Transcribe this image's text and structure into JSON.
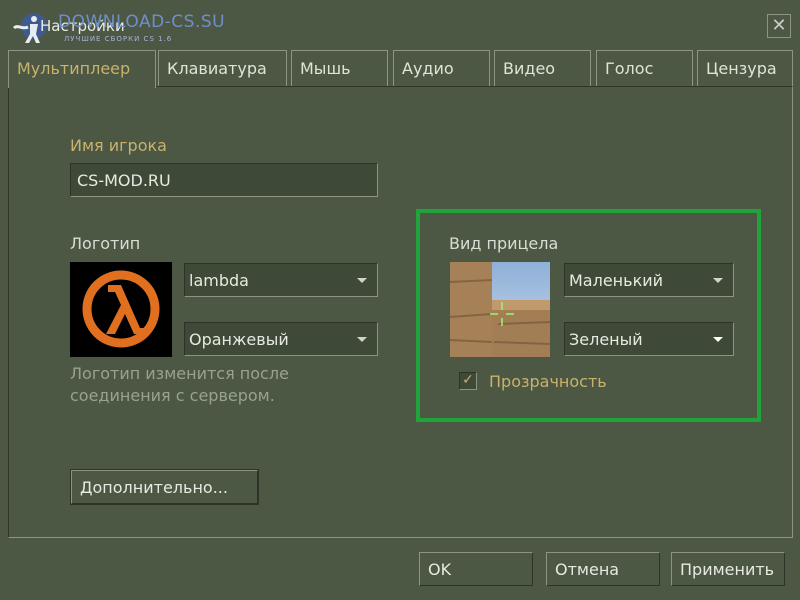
{
  "window": {
    "title": "Настройки",
    "watermark": "DOWNLOAD-CS.SU",
    "watermark_sub": "ЛУЧШИЕ СБОРКИ CS 1.6"
  },
  "tabs": [
    {
      "label": "Мультиплеер",
      "active": true
    },
    {
      "label": "Клавиатура",
      "active": false
    },
    {
      "label": "Мышь",
      "active": false
    },
    {
      "label": "Аудио",
      "active": false
    },
    {
      "label": "Видео",
      "active": false
    },
    {
      "label": "Голос",
      "active": false
    },
    {
      "label": "Цензура",
      "active": false
    }
  ],
  "player": {
    "name_label": "Имя игрока",
    "name_value": "CS-MOD.RU"
  },
  "logo": {
    "label": "Логотип",
    "image": "lambda",
    "color": "Оранжевый",
    "hint": "Логотип изменится после соединения с сервером.",
    "icon": "half-life-lambda-icon"
  },
  "crosshair": {
    "label": "Вид прицела",
    "size": "Маленький",
    "color": "Зеленый",
    "translucent_label": "Прозрачность",
    "translucent": true
  },
  "buttons": {
    "advanced": "Дополнительно...",
    "ok": "OK",
    "cancel": "Отмена",
    "apply": "Применить"
  },
  "colors": {
    "background": "#4c5844",
    "accent_gold": "#c9b26c",
    "highlight_green": "#1fa33a",
    "logo_orange": "#e0701f"
  }
}
